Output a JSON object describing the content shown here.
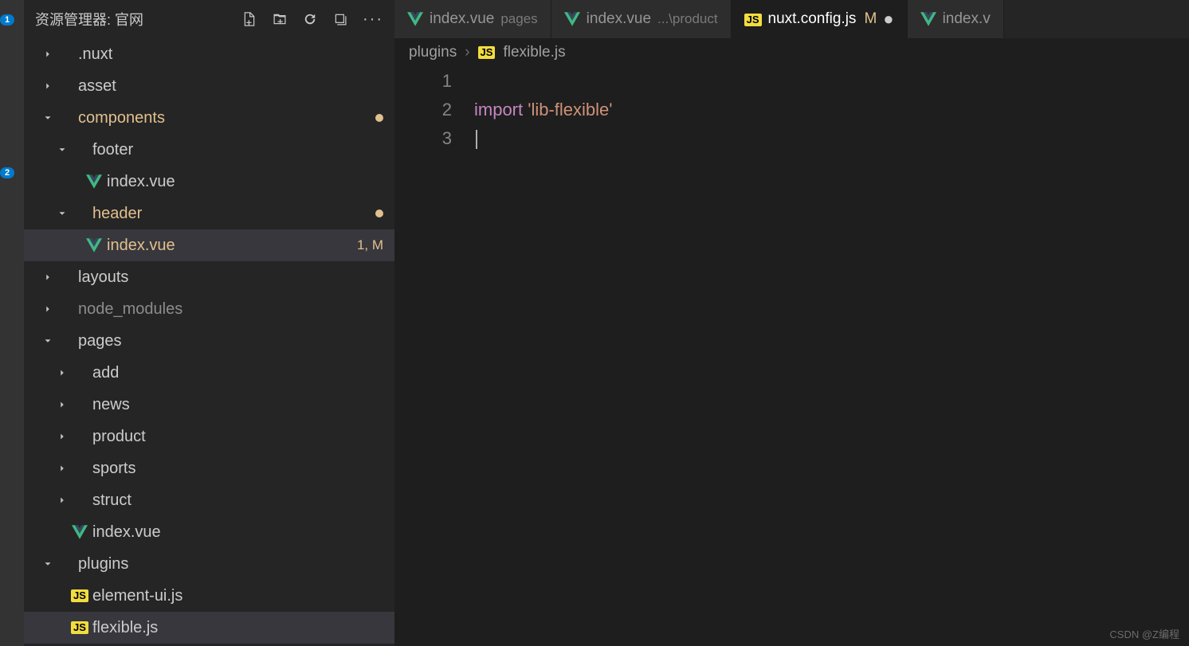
{
  "activity": {
    "badge1": "1",
    "badge2": "2"
  },
  "sidebar": {
    "title": "资源管理器: 官网",
    "tree": [
      {
        "indent": 1,
        "twisty": "right",
        "icon": "none",
        "label": ".nuxt"
      },
      {
        "indent": 1,
        "twisty": "right",
        "icon": "none",
        "label": "asset"
      },
      {
        "indent": 1,
        "twisty": "down",
        "icon": "none",
        "label": "components",
        "mod": true,
        "decor": "dot"
      },
      {
        "indent": 2,
        "twisty": "down",
        "icon": "none",
        "label": "footer"
      },
      {
        "indent": 3,
        "twisty": "blank",
        "icon": "vue",
        "label": "index.vue"
      },
      {
        "indent": 2,
        "twisty": "down",
        "icon": "none",
        "label": "header",
        "mod": true,
        "decor": "dot"
      },
      {
        "indent": 3,
        "twisty": "blank",
        "icon": "vue",
        "label": "index.vue",
        "mod": true,
        "decorText": "1, M",
        "selected": true
      },
      {
        "indent": 1,
        "twisty": "right",
        "icon": "none",
        "label": "layouts"
      },
      {
        "indent": 1,
        "twisty": "right",
        "icon": "none",
        "label": "node_modules",
        "dim": true
      },
      {
        "indent": 1,
        "twisty": "down",
        "icon": "none",
        "label": "pages"
      },
      {
        "indent": 2,
        "twisty": "right",
        "icon": "none",
        "label": "add"
      },
      {
        "indent": 2,
        "twisty": "right",
        "icon": "none",
        "label": "news"
      },
      {
        "indent": 2,
        "twisty": "right",
        "icon": "none",
        "label": "product"
      },
      {
        "indent": 2,
        "twisty": "right",
        "icon": "none",
        "label": "sports"
      },
      {
        "indent": 2,
        "twisty": "right",
        "icon": "none",
        "label": "struct"
      },
      {
        "indent": 2,
        "twisty": "blank",
        "icon": "vue",
        "label": "index.vue"
      },
      {
        "indent": 1,
        "twisty": "down",
        "icon": "none",
        "label": "plugins"
      },
      {
        "indent": 2,
        "twisty": "blank",
        "icon": "js",
        "label": "element-ui.js"
      },
      {
        "indent": 2,
        "twisty": "blank",
        "icon": "js",
        "label": "flexible.js",
        "selected": true
      }
    ]
  },
  "tabs": [
    {
      "icon": "vue",
      "name": "index.vue",
      "desc": "pages"
    },
    {
      "icon": "vue",
      "name": "index.vue",
      "desc": "...\\product"
    },
    {
      "icon": "js",
      "name": "nuxt.config.js",
      "modM": "M",
      "dirty": true,
      "active": true
    },
    {
      "icon": "vue",
      "name": "index.v",
      "truncated": true
    }
  ],
  "breadcrumb": {
    "seg1": "plugins",
    "icon": "js",
    "seg2": "flexible.js"
  },
  "code": {
    "lines": [
      "1",
      "2",
      "3"
    ],
    "line2_kw": "import",
    "line2_str": "'lib-flexible'"
  },
  "watermark": "CSDN @Z编程"
}
